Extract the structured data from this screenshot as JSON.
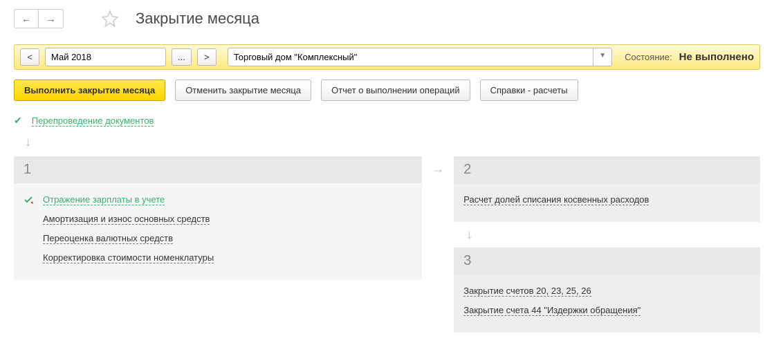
{
  "title": "Закрытие месяца",
  "filter": {
    "prev": "<",
    "next": ">",
    "period": "Май 2018",
    "ellipsis": "...",
    "org": "Торговый дом \"Комплексный\"",
    "status_label": "Состояние:",
    "status_value": "Не выполнено"
  },
  "actions": {
    "execute": "Выполнить закрытие месяца",
    "cancel": "Отменить закрытие месяца",
    "report": "Отчет о выполнении операций",
    "refs": "Справки - расчеты"
  },
  "reprocess": "Перепроведение документов",
  "stages": {
    "s1": {
      "num": "1",
      "items": [
        {
          "label": "Отражение зарплаты в учете",
          "done": true
        },
        {
          "label": "Амортизация и износ основных средств",
          "done": false
        },
        {
          "label": "Переоценка валютных средств",
          "done": false
        },
        {
          "label": "Корректировка стоимости номенклатуры",
          "done": false
        }
      ]
    },
    "s2": {
      "num": "2",
      "items": [
        {
          "label": "Расчет долей списания косвенных расходов",
          "done": false
        }
      ]
    },
    "s3": {
      "num": "3",
      "items": [
        {
          "label": "Закрытие счетов 20, 23, 25, 26",
          "done": false
        },
        {
          "label": "Закрытие счета 44 \"Издержки обращения\"",
          "done": false
        }
      ]
    }
  }
}
